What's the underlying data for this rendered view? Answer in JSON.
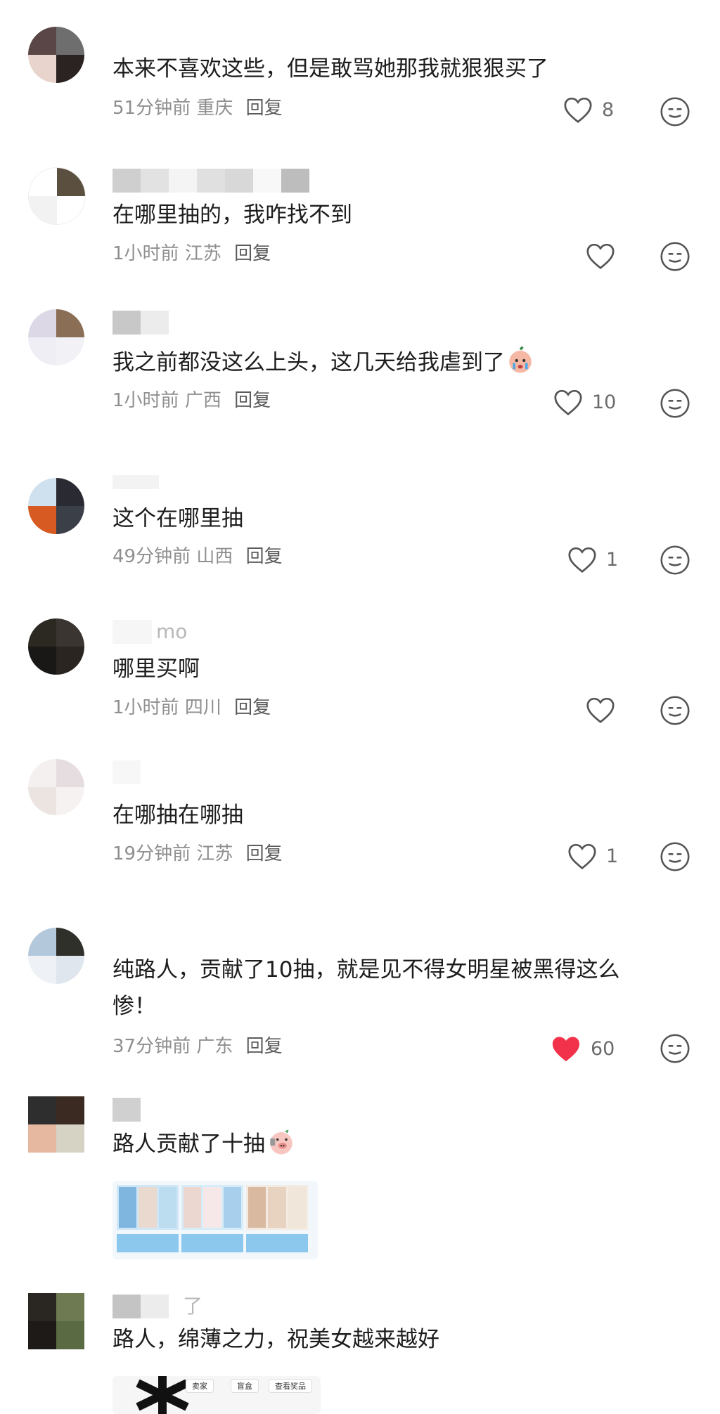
{
  "comments": [
    {
      "text": "本来不喜欢这些，但是敢骂她那我就狠狠买了",
      "time": "51分钟前",
      "loc": "重庆",
      "reply": "回复",
      "likes": "8",
      "liked": false,
      "avatar": [
        "#5a4646",
        "#6e6e6e",
        "#e8d4cc",
        "#2b2222"
      ]
    },
    {
      "username_tail": "",
      "text": "在哪里抽的，我咋找不到",
      "time": "1小时前",
      "loc": "江苏",
      "reply": "回复",
      "likes": "",
      "liked": false,
      "avatar": [
        "#ffffff",
        "#5b5040",
        "#f2f2f2",
        "#ffffff"
      ]
    },
    {
      "text": "我之前都没这么上头，这几天给我虐到了",
      "time": "1小时前",
      "loc": "广西",
      "reply": "回复",
      "likes": "10",
      "liked": false,
      "avatar": [
        "#ddd8e6",
        "#8a6e55",
        "#f0eef5",
        "#f2f2f6"
      ]
    },
    {
      "text": "这个在哪里抽",
      "time": "49分钟前",
      "loc": "山西",
      "reply": "回复",
      "likes": "1",
      "liked": false,
      "avatar": [
        "#cfe0ee",
        "#2a2a33",
        "#d65a22",
        "#3a3f48"
      ]
    },
    {
      "username_tail": "mo",
      "text": "哪里买啊",
      "time": "1小时前",
      "loc": "四川",
      "reply": "回复",
      "likes": "",
      "liked": false,
      "avatar": [
        "#2c2822",
        "#3a3530",
        "#1a1816",
        "#2a2520"
      ]
    },
    {
      "text": "在哪抽在哪抽",
      "time": "19分钟前",
      "loc": "江苏",
      "reply": "回复",
      "likes": "1",
      "liked": false,
      "avatar": [
        "#f4f0f0",
        "#e6dde0",
        "#ece4e0",
        "#f6f2f2"
      ]
    },
    {
      "text_line1": "纯路人，贡献了10抽，就是见不得女明星被黑得这么",
      "text_line2": "惨！",
      "time": "37分钟前",
      "loc": "广东",
      "reply": "回复",
      "likes": "60",
      "liked": true,
      "avatar": [
        "#b4c8dc",
        "#30302a",
        "#eef2f6",
        "#dfe6ee"
      ]
    },
    {
      "text": "路人贡献了十抽",
      "avatar": [
        "#2e2e2e",
        "#3a2a22",
        "#e6b8a0",
        "#d6d2c4"
      ]
    },
    {
      "username_tail": "了",
      "text": "路人，绵薄之力，祝美女越来越好",
      "avatar": [
        "#2a2622",
        "#6e7a52",
        "#1e1a18",
        "#5a6a42"
      ]
    }
  ],
  "attachment_tabs": [
    "卖家",
    "盲盒",
    "查看奖品"
  ],
  "colors": {
    "liked": "#f2324a",
    "icon": "#5a5a5a"
  }
}
